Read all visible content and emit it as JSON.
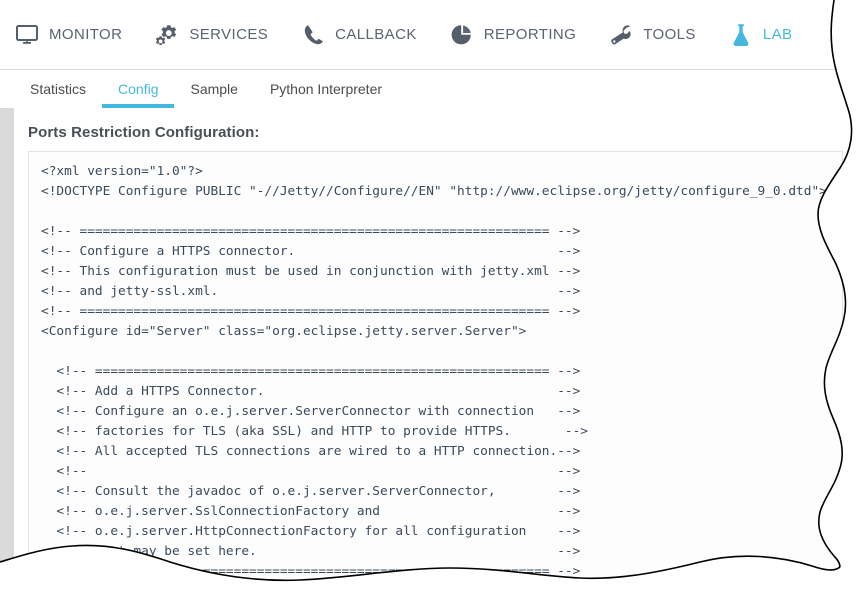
{
  "topnav": {
    "items": [
      {
        "label": "MONITOR",
        "icon": "monitor-icon",
        "active": false
      },
      {
        "label": "SERVICES",
        "icon": "gears-icon",
        "active": false
      },
      {
        "label": "CALLBACK",
        "icon": "phone-icon",
        "active": false
      },
      {
        "label": "REPORTING",
        "icon": "pie-chart-icon",
        "active": false
      },
      {
        "label": "TOOLS",
        "icon": "wrench-icon",
        "active": false
      },
      {
        "label": "LAB",
        "icon": "flask-icon",
        "active": true
      }
    ]
  },
  "tabs": {
    "items": [
      {
        "label": "Statistics",
        "active": false
      },
      {
        "label": "Config",
        "active": true
      },
      {
        "label": "Sample",
        "active": false
      },
      {
        "label": "Python Interpreter",
        "active": false
      }
    ]
  },
  "main": {
    "page_title": "Ports Restriction Configuration:",
    "config_code": "<?xml version=\"1.0\"?>\n<!DOCTYPE Configure PUBLIC \"-//Jetty//Configure//EN\" \"http://www.eclipse.org/jetty/configure_9_0.dtd\">\n\n<!-- ============================================================= -->\n<!-- Configure a HTTPS connector.                                  -->\n<!-- This configuration must be used in conjunction with jetty.xml -->\n<!-- and jetty-ssl.xml.                                            -->\n<!-- ============================================================= -->\n<Configure id=\"Server\" class=\"org.eclipse.jetty.server.Server\">\n\n  <!-- =========================================================== -->\n  <!-- Add a HTTPS Connector.                                      -->\n  <!-- Configure an o.e.j.server.ServerConnector with connection   -->\n  <!-- factories for TLS (aka SSL) and HTTP to provide HTTPS.       -->\n  <!-- All accepted TLS connections are wired to a HTTP connection.-->\n  <!--                                                             -->\n  <!-- Consult the javadoc of o.e.j.server.ServerConnector,        -->\n  <!-- o.e.j.server.SslConnectionFactory and                       -->\n  <!-- o.e.j.server.HttpConnectionFactory for all configuration    -->\n  <!-- that may be set here.                                       -->\n  <!-- =========================================================== -->"
  },
  "colors": {
    "accent": "#45b8e0",
    "nav_text": "#5b6470",
    "page_background": "#dadada",
    "code_text": "#3b4a5a",
    "torn_edge": "#000000"
  }
}
